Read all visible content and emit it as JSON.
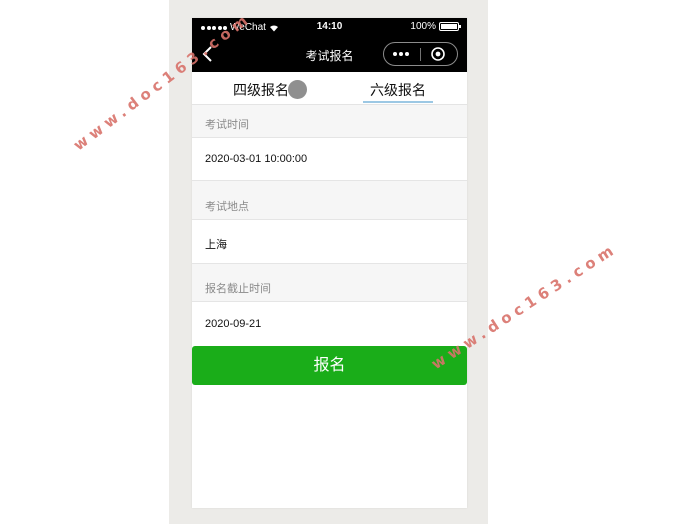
{
  "status_bar": {
    "carrier": "WeChat",
    "time": "14:10",
    "battery": "100%"
  },
  "nav": {
    "title": "考试报名"
  },
  "tabs": [
    {
      "label": "四级报名"
    },
    {
      "label": "六级报名"
    }
  ],
  "form": {
    "exam_time_label": "考试时间",
    "exam_time_value": "2020-03-01 10:00:00",
    "location_label": "考试地点",
    "location_value": "上海",
    "deadline_label": "报名截止时间",
    "deadline_value": "2020-09-21"
  },
  "submit_label": "报名",
  "watermark": "www.doc163.com",
  "colors": {
    "primary_button": "#1aad19",
    "tab_underline": "#9cc8e4",
    "watermark": "#d9736b"
  }
}
